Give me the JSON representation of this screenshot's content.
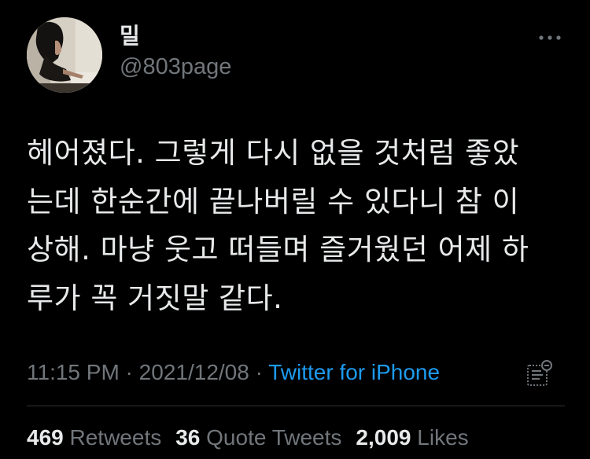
{
  "author": {
    "display_name": "밀",
    "handle": "@803page"
  },
  "tweet": {
    "lines": [
      "헤어졌다. 그렇게 다시 없을 것처럼 좋았",
      "는데 한순간에 끝나버릴 수 있다니 참 이",
      "상해. 마냥 웃고 떠들며 즐거웠던 어제 하",
      "루가 꼭 거짓말 같다."
    ]
  },
  "meta": {
    "time": "11:15 PM",
    "separator1": " · ",
    "date": "2021/12/08",
    "separator2": " · ",
    "source": "Twitter for iPhone"
  },
  "stats": {
    "retweets_count": "469",
    "retweets_label": "Retweets",
    "quotes_count": "36",
    "quotes_label": "Quote Tweets",
    "likes_count": "2,009",
    "likes_label": "Likes"
  },
  "colors": {
    "background": "#000000",
    "primary_text": "#e7e9ea",
    "secondary_text": "#71767b",
    "link": "#1d9bf0",
    "divider": "#2f3336"
  },
  "icons": {
    "more": "more-horizontal-icon",
    "analytics": "analytics-icon"
  }
}
